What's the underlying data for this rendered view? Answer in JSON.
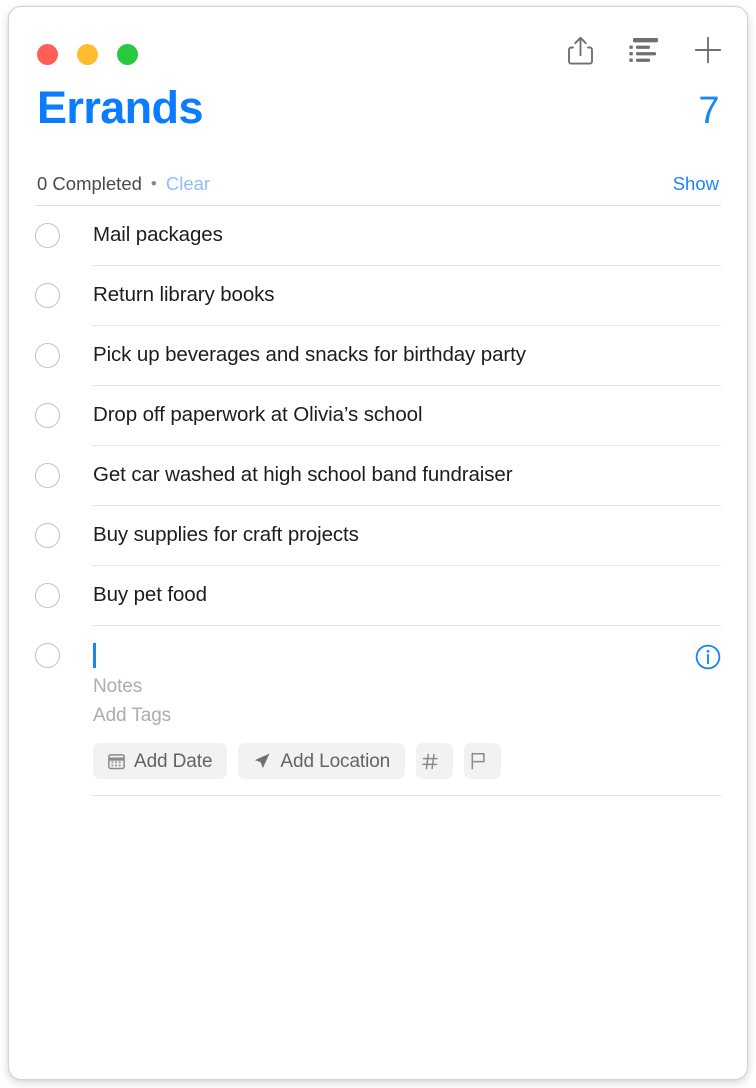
{
  "window": {
    "traffic_lights": [
      {
        "name": "close",
        "color": "#ff5f57"
      },
      {
        "name": "minimize",
        "color": "#febc2e"
      },
      {
        "name": "maximize",
        "color": "#28c840"
      }
    ],
    "toolbar": [
      {
        "icon": "share-icon",
        "label": "Share"
      },
      {
        "icon": "list-view-icon",
        "label": "List Options"
      },
      {
        "icon": "plus-icon",
        "label": "Add Reminder"
      }
    ]
  },
  "header": {
    "title": "Errands",
    "count": "7",
    "completed_text": "0 Completed",
    "separator_dot": "•",
    "clear_label": "Clear",
    "show_label": "Show",
    "accent_color": "#0a7cff",
    "muted_accent_color": "#8fbffc"
  },
  "tasks": [
    {
      "title": "Mail packages",
      "completed": false
    },
    {
      "title": "Return library books",
      "completed": false
    },
    {
      "title": "Pick up beverages and snacks for birthday party",
      "completed": false
    },
    {
      "title": "Drop off paperwork at Olivia’s school",
      "completed": false
    },
    {
      "title": "Get car washed at high school band fundraiser",
      "completed": false
    },
    {
      "title": "Buy supplies for craft projects",
      "completed": false
    },
    {
      "title": "Buy pet food",
      "completed": false
    }
  ],
  "new_item": {
    "value": "",
    "notes_placeholder": "Notes",
    "tags_placeholder": "Add Tags",
    "info_icon": "info-circle-icon",
    "chips": [
      {
        "icon": "calendar-icon",
        "label": "Add Date"
      },
      {
        "icon": "location-arrow-icon",
        "label": "Add Location"
      },
      {
        "icon": "hashtag-icon",
        "label": ""
      },
      {
        "icon": "flag-icon",
        "label": ""
      }
    ]
  }
}
